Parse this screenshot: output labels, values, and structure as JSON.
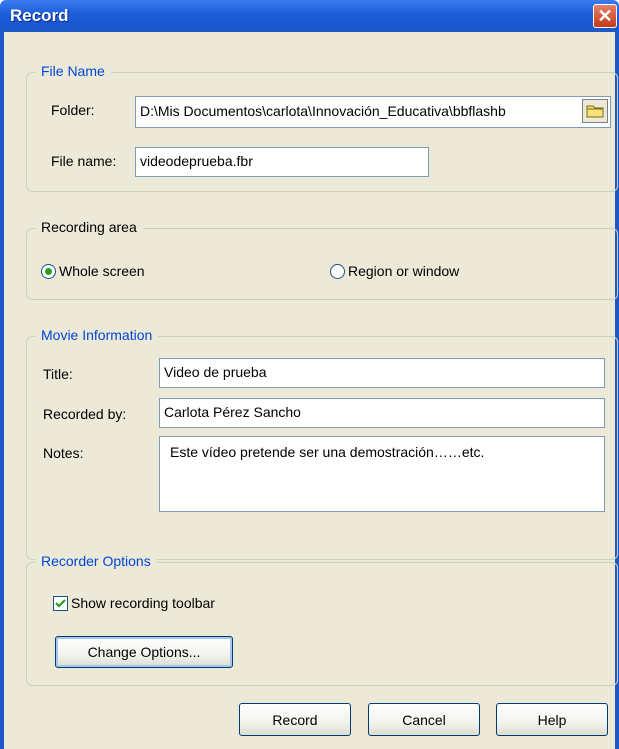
{
  "window": {
    "title": "Record"
  },
  "file_name": {
    "legend": "File Name",
    "folder_label": "Folder:",
    "folder_value": "D:\\Mis Documentos\\carlota\\Innovación_Educativa\\bbflashb",
    "file_label": "File name:",
    "file_value": "videodeprueba.fbr"
  },
  "recording_area": {
    "legend": "Recording area",
    "option_whole": "Whole screen",
    "option_region": "Region or window",
    "selected": "Whole screen"
  },
  "movie_info": {
    "legend": "Movie Information",
    "title_label": "Title:",
    "title_value": "Video de prueba",
    "recorded_label": "Recorded by:",
    "recorded_value": "Carlota Pérez Sancho",
    "notes_label": "Notes:",
    "notes_value": "Este vídeo pretende ser una demostración……etc."
  },
  "recorder_options": {
    "legend": "Recorder Options",
    "show_toolbar_label": "Show recording toolbar",
    "show_toolbar_checked": true,
    "change_options_label": "Change Options..."
  },
  "buttons": {
    "record": "Record",
    "cancel": "Cancel",
    "help": "Help"
  },
  "colors": {
    "title_bar": "#1d58c9",
    "dialog_bg": "#ece9d8",
    "group_legend_blue": "#0046d5",
    "radio_dot": "#21a121"
  }
}
